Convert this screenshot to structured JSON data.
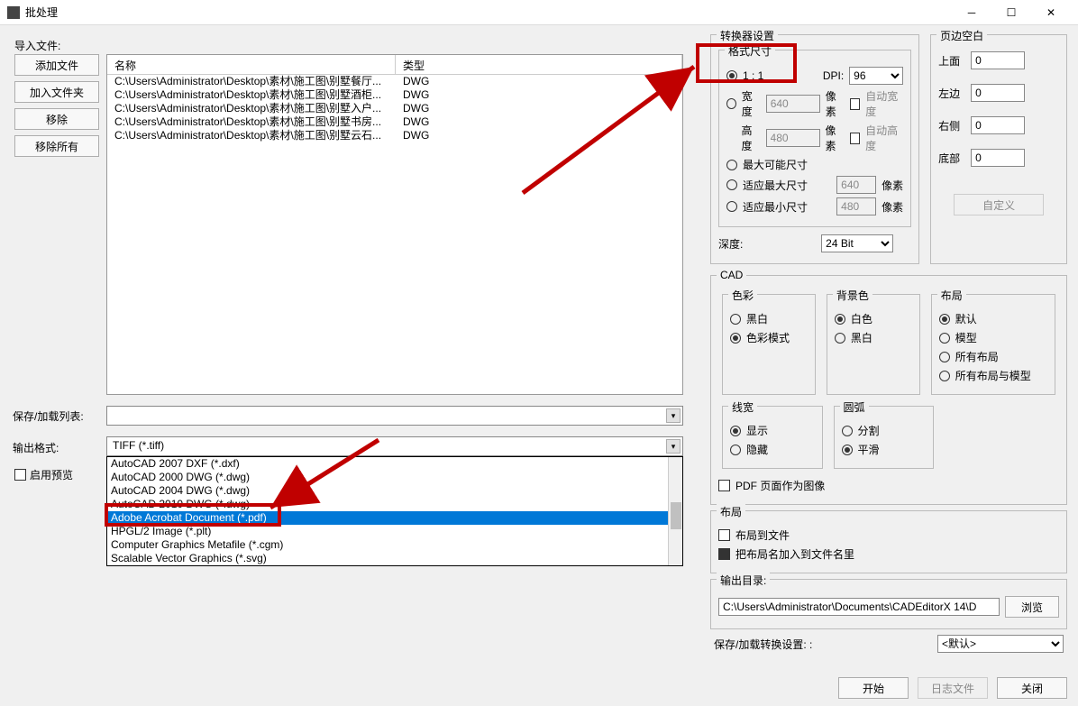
{
  "window": {
    "title": "批处理"
  },
  "import": {
    "label": "导入文件:",
    "buttons": {
      "add_file": "添加文件",
      "add_folder": "加入文件夹",
      "remove": "移除",
      "remove_all": "移除所有"
    },
    "headers": {
      "name": "名称",
      "type": "类型"
    },
    "files": [
      {
        "name": "C:\\Users\\Administrator\\Desktop\\素材\\施工图\\别墅餐厅...",
        "type": "DWG"
      },
      {
        "name": "C:\\Users\\Administrator\\Desktop\\素材\\施工图\\别墅酒柜...",
        "type": "DWG"
      },
      {
        "name": "C:\\Users\\Administrator\\Desktop\\素材\\施工图\\别墅入户...",
        "type": "DWG"
      },
      {
        "name": "C:\\Users\\Administrator\\Desktop\\素材\\施工图\\别墅书房...",
        "type": "DWG"
      },
      {
        "name": "C:\\Users\\Administrator\\Desktop\\素材\\施工图\\别墅云石...",
        "type": "DWG"
      }
    ]
  },
  "save_load_list_label": "保存/加载列表:",
  "output_format": {
    "label": "输出格式:",
    "current": "TIFF (*.tiff)",
    "options": [
      "AutoCAD 2007 DXF (*.dxf)",
      "AutoCAD 2000 DWG (*.dwg)",
      "AutoCAD 2004 DWG (*.dwg)",
      "AutoCAD 2010 DWG (*.dwg)",
      "Adobe Acrobat Document (*.pdf)",
      "HPGL/2 Image (*.plt)",
      "Computer Graphics Metafile (*.cgm)",
      "Scalable Vector Graphics (*.svg)"
    ],
    "selected_index": 4
  },
  "enable_preview": "启用预览",
  "converter": {
    "title": "转换器设置",
    "format_title": "格式尺寸",
    "ratio_1_1": "1 : 1",
    "dpi_label": "DPI:",
    "dpi_value": "96",
    "width_label": "宽度",
    "width_value": "640",
    "pixel": "像素",
    "auto_width": "自动宽度",
    "height_label": "高度",
    "height_value": "480",
    "auto_height": "自动高度",
    "max_possible": "最大可能尺寸",
    "fit_max": "适应最大尺寸",
    "fit_max_value": "640",
    "fit_min": "适应最小尺寸",
    "fit_min_value": "480",
    "depth_label": "深度:",
    "depth_value": "24 Bit"
  },
  "page_margin": {
    "title": "页边空白",
    "top": "上面",
    "top_v": "0",
    "left": "左边",
    "left_v": "0",
    "right": "右侧",
    "right_v": "0",
    "bottom": "底部",
    "bottom_v": "0",
    "customize": "自定义"
  },
  "cad": {
    "title": "CAD",
    "color_title": "色彩",
    "bw": "黑白",
    "color_mode": "色彩模式",
    "bg_title": "背景色",
    "white": "白色",
    "black": "黑白",
    "layout_title": "布局",
    "default": "默认",
    "model": "模型",
    "all_layout": "所有布局",
    "all_layout_model": "所有布局与模型",
    "line_title": "线宽",
    "show": "显示",
    "hide": "隐藏",
    "arc_title": "圆弧",
    "split": "分割",
    "smooth": "平滑",
    "pdf_as_image": "PDF 页面作为图像"
  },
  "layout": {
    "title": "布局",
    "to_file": "布局到文件",
    "append_name": "把布局名加入到文件名里"
  },
  "output_dir": {
    "title": "输出目录:",
    "value": "C:\\Users\\Administrator\\Documents\\CADEditorX 14\\D",
    "browse": "浏览"
  },
  "save_convert": {
    "label": "保存/加载转换设置: :",
    "value": "<默认>"
  },
  "footer": {
    "start": "开始",
    "log": "日志文件",
    "close": "关闭"
  }
}
